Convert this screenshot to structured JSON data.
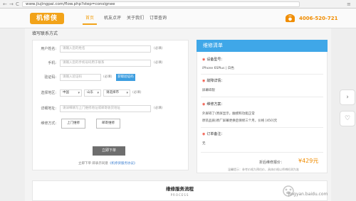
{
  "browser": {
    "url": "www.jiujingpai.com/flow.php?step=consignee",
    "back_glyph": "←",
    "forward_glyph": "→",
    "reload_glyph": "C",
    "menu_glyph": "≡"
  },
  "header": {
    "logo_text": "机修侠",
    "nav": [
      "首页",
      "机友点评",
      "关于我们",
      "订单查询"
    ],
    "phone": "4006-520-721"
  },
  "form": {
    "section_title": "填写联系方式",
    "name_label": "用户姓名:",
    "name_placeholder": "请输入您的姓名",
    "name_req": "(必填)",
    "phone_label": "手机:",
    "phone_placeholder": "请输入您的手机号码用于联系",
    "phone_req": "(必填)",
    "code_label": "验证码:",
    "code_placeholder": "请输入验证码",
    "code_req": "(必填)",
    "code_button": "获取验证码",
    "area_label": "选择地区:",
    "country": "中国",
    "province": "山东",
    "city": "请选择市",
    "area_req": "(必填)",
    "address_label": "详细地址:",
    "address_placeholder": "请详细填写上门维修地址或邮寄收货地址",
    "address_req": "(必填)",
    "method_label": "维修方式:",
    "method_onsite": "上门维修",
    "method_mail": "邮寄维修",
    "submit": "立即下单",
    "agree_prefix": "立即下单 即表示同意",
    "agree_link": "《机修侠服务协议》"
  },
  "repair_list": {
    "title": "维修清单",
    "device_title": "设备型号：",
    "device_value": "iPhone 6SPlus | 白色",
    "fault_title": "故障详情：",
    "fault_value": "屏幕碎裂",
    "plan_title": "维修方案：",
    "plan_line1": "外屏碎了(原屏显示，触摸和功能正常",
    "plan_line2": "原装品质)原厂屏幕更换后保修三个月，价格 [450]元",
    "remark_title": "订单备注：",
    "remark_value": "无",
    "price_label": "折后维修报价：",
    "price_value": "¥429元",
    "note": "温馨提示：参考价格为预估价，具体价格以师傅检测为准"
  },
  "side_buttons": [
    "›",
    "♡"
  ],
  "process": {
    "title": "维修服务流程",
    "subtitle": "PROCESS"
  },
  "watermark": "jingyan.baidu.com",
  "colors": {
    "brand_orange": "#f2a319",
    "accent_blue": "#3fa7e8",
    "price_orange": "#f08c00"
  }
}
